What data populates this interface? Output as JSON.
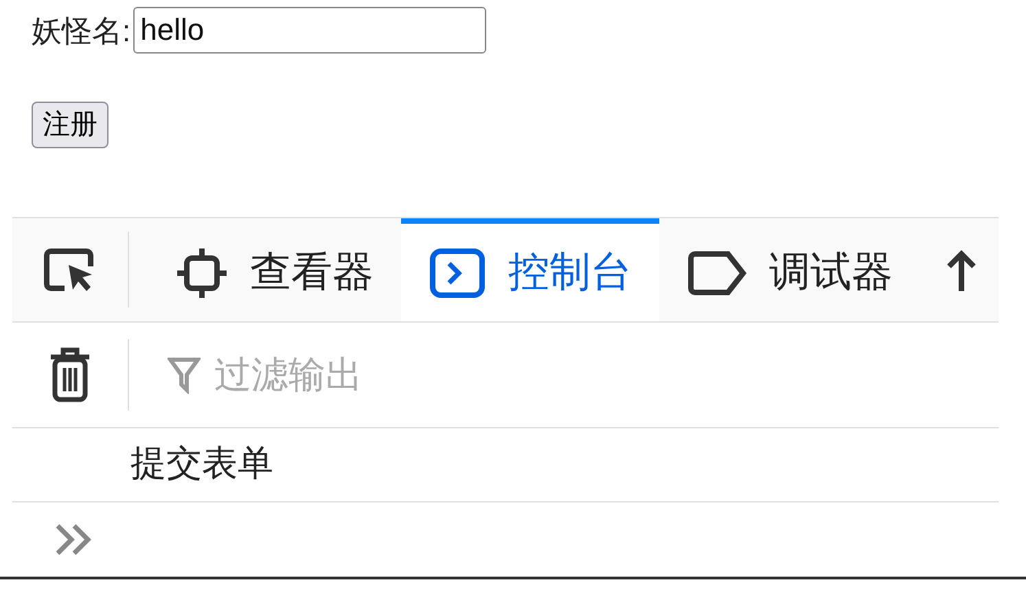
{
  "form": {
    "label": "妖怪名:",
    "input_value": "hello",
    "submit_button": "注册"
  },
  "devtools": {
    "tabs": [
      {
        "kind": "inspector",
        "label": "查看器",
        "selected": false
      },
      {
        "kind": "console",
        "label": "控制台",
        "selected": true
      },
      {
        "kind": "debugger",
        "label": "调试器",
        "selected": false
      }
    ],
    "filter": {
      "placeholder": "过滤输出"
    },
    "console_messages": [
      "提交表单"
    ]
  }
}
